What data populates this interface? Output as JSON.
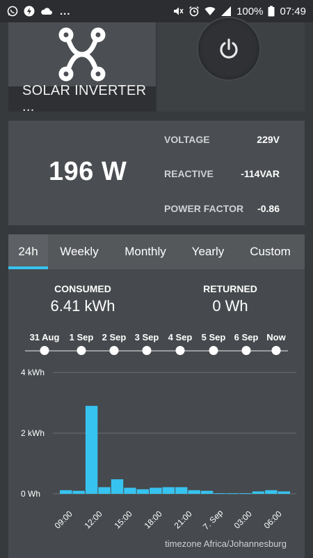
{
  "status_bar": {
    "left_icons": [
      "whatsapp-icon",
      "lightning-icon",
      "cloud-icon"
    ],
    "dots": "...",
    "battery": "100%",
    "time": "07:49"
  },
  "device": {
    "name": "SOLAR INVERTER ...",
    "icon": "network-hub-icon"
  },
  "power_button": {
    "icon": "power-icon"
  },
  "stats": {
    "current_power": "196 W",
    "rows": [
      {
        "label": "VOLTAGE",
        "value": "229V"
      },
      {
        "label": "REACTIVE",
        "value": "-114VAR"
      },
      {
        "label": "POWER FACTOR",
        "value": "-0.86"
      }
    ]
  },
  "tabs": [
    {
      "label": "24h",
      "active": true
    },
    {
      "label": "Weekly",
      "active": false
    },
    {
      "label": "Monthly",
      "active": false
    },
    {
      "label": "Yearly",
      "active": false
    },
    {
      "label": "Custom",
      "active": false
    }
  ],
  "summary": {
    "consumed_label": "CONSUMED",
    "consumed_value": "6.41 kWh",
    "returned_label": "RETURNED",
    "returned_value": "0 Wh"
  },
  "timeline": [
    "31 Aug",
    "1 Sep",
    "2 Sep",
    "3 Sep",
    "4 Sep",
    "5 Sep",
    "6 Sep",
    "Now"
  ],
  "timezone": "timezone Africa/Johannesburg",
  "colors": {
    "accent": "#37c3f0",
    "bar": "#37c3f0"
  },
  "chart_data": {
    "type": "bar",
    "ylabel": "",
    "xlabel": "",
    "yticks": [
      "0 Wh",
      "2 kWh",
      "4 kWh"
    ],
    "ylim": [
      0,
      4
    ],
    "xticks": [
      "09:00",
      "12:00",
      "15:00",
      "18:00",
      "21:00",
      "7. Sep",
      "03:00",
      "06:00"
    ],
    "values_kwh": [
      0.12,
      0.1,
      2.9,
      0.22,
      0.48,
      0.2,
      0.15,
      0.2,
      0.22,
      0.22,
      0.12,
      0.1,
      0.02,
      0.02,
      0.02,
      0.08,
      0.12,
      0.08
    ]
  }
}
